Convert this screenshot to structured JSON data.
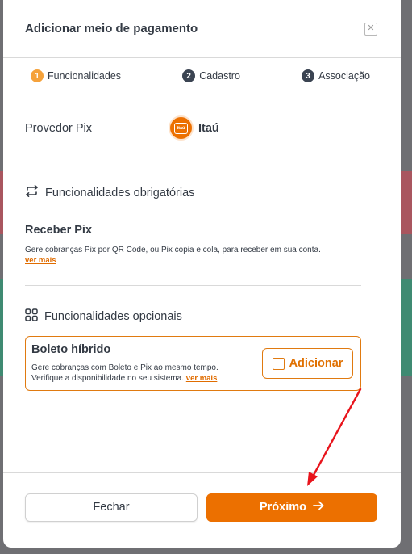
{
  "modal": {
    "title": "Adicionar meio de pagamento",
    "close_icon": "close-x-icon"
  },
  "stepper": {
    "steps": [
      {
        "number": "1",
        "label": "Funcionalidades",
        "active": true
      },
      {
        "number": "2",
        "label": "Cadastro",
        "active": false
      },
      {
        "number": "3",
        "label": "Associação",
        "active": false
      }
    ]
  },
  "provider": {
    "label": "Provedor Pix",
    "bank_name": "Itaú",
    "bank_logo_text": "itaú",
    "bank_color": "#ec7000"
  },
  "required_section": {
    "icon": "swap-arrows-icon",
    "title": "Funcionalidades obrigatórias",
    "feature": {
      "title": "Receber Pix",
      "description": "Gere cobranças Pix por QR Code, ou Pix copia e cola, para receber em sua conta.",
      "link": "ver mais"
    }
  },
  "optional_section": {
    "icon": "grid-icon",
    "title": "Funcionalidades opcionais",
    "feature": {
      "title": "Boleto híbrido",
      "description_line1": "Gere cobranças com Boleto e Pix ao mesmo tempo.",
      "description_line2": "Verifique a disponibilidade no seu sistema.",
      "link": "ver mais",
      "add_label": "Adicionar"
    }
  },
  "footer": {
    "close_label": "Fechar",
    "next_label": "Próximo",
    "next_icon": "arrow-right-icon"
  },
  "colors": {
    "accent": "#ec7000",
    "text": "#333a44",
    "annotation": "#e8141c"
  }
}
